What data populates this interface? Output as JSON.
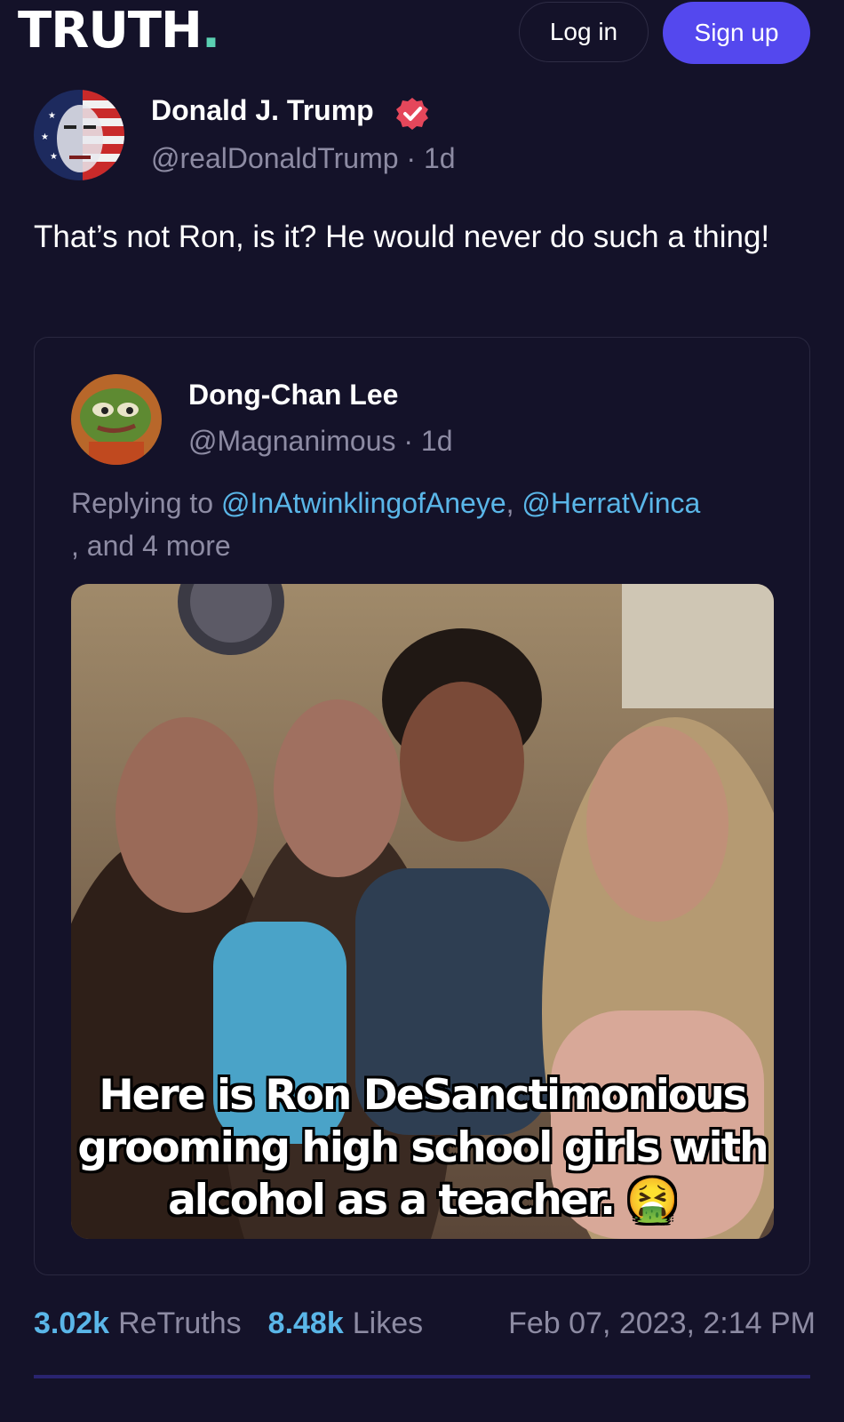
{
  "header": {
    "logo_text": "TRUTH",
    "logo_dot": ".",
    "login_label": "Log in",
    "signup_label": "Sign up"
  },
  "post": {
    "author_name": "Donald J. Trump",
    "author_handle": "@realDonaldTrump · 1d",
    "text": "That’s not Ron, is it? He would never do such a thing!"
  },
  "quoted_post": {
    "author_name": "Dong-Chan Lee",
    "author_handle": "@Magnanimous · 1d",
    "replying_prefix": "Replying to ",
    "mention_1": "@InAtwinklingofAneye",
    "separator": ", ",
    "mention_2": "@HerratVinca",
    "replying_suffix": ", and 4 more",
    "image_caption": "Here is Ron DeSanctimonious grooming high school girls with alcohol as a teacher. 🤮"
  },
  "stats": {
    "retruths_count": "3.02k",
    "retruths_label": "ReTruths",
    "likes_count": "8.48k",
    "likes_label": "Likes",
    "timestamp": "Feb 07, 2023, 2:14 PM"
  },
  "colors": {
    "background": "#141229",
    "accent": "#5448ee",
    "link": "#5ab6e8",
    "verified": "#e5475b"
  }
}
